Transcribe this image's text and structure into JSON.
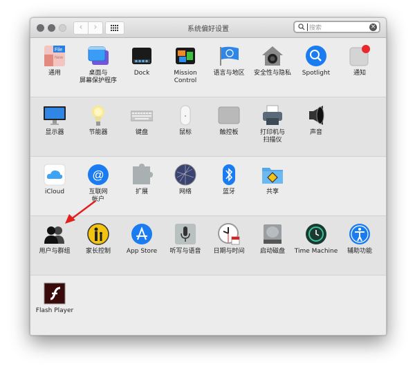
{
  "window": {
    "title": "系统偏好设置",
    "search": {
      "placeholder": "搜索",
      "value": ""
    },
    "nav": {
      "back": "‹",
      "forward": "›"
    }
  },
  "sections": [
    {
      "items": [
        {
          "id": "general",
          "label": "通用",
          "icon": "general-icon"
        },
        {
          "id": "desktop",
          "label": "桌面与\n屏幕保护程序",
          "icon": "desktop-screensaver-icon"
        },
        {
          "id": "dock",
          "label": "Dock",
          "icon": "dock-icon"
        },
        {
          "id": "mission",
          "label": "Mission\nControl",
          "icon": "mission-control-icon"
        },
        {
          "id": "language",
          "label": "语言与地区",
          "icon": "language-region-icon"
        },
        {
          "id": "security",
          "label": "安全性与隐私",
          "icon": "security-privacy-icon"
        },
        {
          "id": "spotlight",
          "label": "Spotlight",
          "icon": "spotlight-icon"
        },
        {
          "id": "notifications",
          "label": "通知",
          "icon": "notifications-icon"
        }
      ]
    },
    {
      "items": [
        {
          "id": "displays",
          "label": "显示器",
          "icon": "displays-icon"
        },
        {
          "id": "energy",
          "label": "节能器",
          "icon": "energy-saver-icon"
        },
        {
          "id": "keyboard",
          "label": "键盘",
          "icon": "keyboard-icon"
        },
        {
          "id": "mouse",
          "label": "鼠标",
          "icon": "mouse-icon"
        },
        {
          "id": "trackpad",
          "label": "触控板",
          "icon": "trackpad-icon"
        },
        {
          "id": "printers",
          "label": "打印机与\n扫描仪",
          "icon": "printers-scanners-icon"
        },
        {
          "id": "sound",
          "label": "声音",
          "icon": "sound-icon"
        }
      ]
    },
    {
      "items": [
        {
          "id": "icloud",
          "label": "iCloud",
          "icon": "icloud-icon"
        },
        {
          "id": "internet",
          "label": "互联网\n帐户",
          "icon": "internet-accounts-icon"
        },
        {
          "id": "extensions",
          "label": "扩展",
          "icon": "extensions-icon"
        },
        {
          "id": "network",
          "label": "网络",
          "icon": "network-icon"
        },
        {
          "id": "bluetooth",
          "label": "蓝牙",
          "icon": "bluetooth-icon"
        },
        {
          "id": "sharing",
          "label": "共享",
          "icon": "sharing-icon"
        }
      ]
    },
    {
      "items": [
        {
          "id": "users",
          "label": "用户与群组",
          "icon": "users-groups-icon"
        },
        {
          "id": "parental",
          "label": "家长控制",
          "icon": "parental-controls-icon"
        },
        {
          "id": "appstore",
          "label": "App Store",
          "icon": "app-store-icon"
        },
        {
          "id": "dictation",
          "label": "听写与语音",
          "icon": "dictation-speech-icon"
        },
        {
          "id": "datetime",
          "label": "日期与时间",
          "icon": "date-time-icon"
        },
        {
          "id": "startup",
          "label": "启动磁盘",
          "icon": "startup-disk-icon"
        },
        {
          "id": "timemachine",
          "label": "Time Machine",
          "icon": "time-machine-icon"
        },
        {
          "id": "accessibility",
          "label": "辅助功能",
          "icon": "accessibility-icon"
        }
      ]
    },
    {
      "items": [
        {
          "id": "flash",
          "label": "Flash Player",
          "icon": "flash-player-icon"
        }
      ]
    }
  ],
  "annotation": {
    "arrow_color": "#e0201c",
    "points_to": "users"
  },
  "colors": {
    "notification_badge": "#e8282b",
    "accent_blue": "#1a7cf0"
  }
}
